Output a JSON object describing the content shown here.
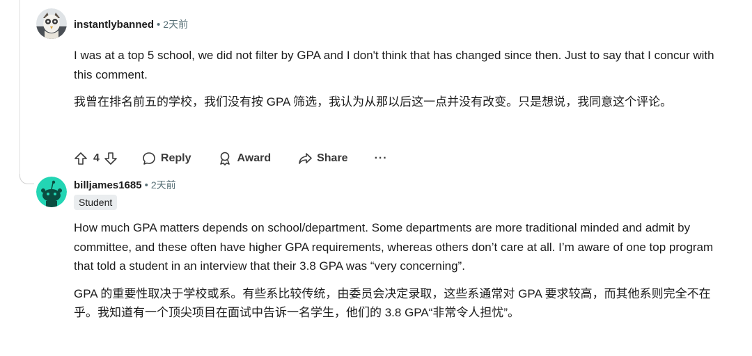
{
  "comments": [
    {
      "username": "instantlybanned",
      "time": "2天前",
      "paragraphs": [
        "I was at a top 5 school, we did not filter by GPA and I don't think that has changed since then. Just to say that I concur with this comment.",
        "我曾在排名前五的学校，我们没有按 GPA 筛选，我认为从那以后这一点并没有改变。只是想说，我同意这个评论。"
      ],
      "votes": "4",
      "reply_label": "Reply",
      "award_label": "Award",
      "share_label": "Share",
      "more_label": "···"
    },
    {
      "username": "billjames1685",
      "time": "2天前",
      "flair": "Student",
      "paragraphs": [
        "How much GPA matters depends on school/department. Some departments are more traditional minded and admit by committee, and these often have higher GPA requirements, whereas others don’t care at all. I’m aware of one top program that told a student in an interview that their 3.8 GPA was “very concerning”.",
        "GPA 的重要性取决于学校或系。有些系比较传统，由委员会决定录取，这些系通常对 GPA 要求较高，而其他系则完全不在乎。我知道有一个顶尖项目在面试中告诉一名学生，他们的 3.8 GPA“非常令人担忧”。"
      ]
    }
  ],
  "colors": {
    "text": "#1c1c1c",
    "meta": "#576f76",
    "flair_bg": "#eaedef",
    "snoo": "#23d5b4"
  }
}
